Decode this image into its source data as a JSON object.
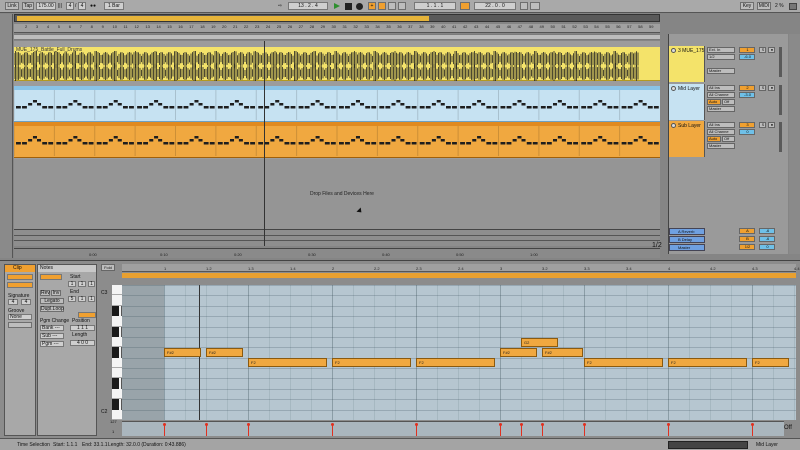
{
  "transport": {
    "link": "Link",
    "tap": "Tap",
    "tempo": "175.00",
    "sig_num": "4",
    "sig_den": "4",
    "quant": "1 Bar",
    "position": "13 .  2 .  4",
    "loop_start": "1 .  1 .  1",
    "loop_length": "22 .  0 .  0",
    "key": "Key",
    "midi": "MIDI",
    "cpu": "2 %"
  },
  "ruler_top": [
    "2",
    "3",
    "4",
    "5",
    "6",
    "7",
    "8",
    "9",
    "10",
    "11",
    "12",
    "13",
    "14",
    "15",
    "16",
    "17",
    "18",
    "19",
    "20",
    "21",
    "22",
    "23",
    "24",
    "25",
    "26",
    "27",
    "28",
    "29",
    "30",
    "31",
    "32",
    "33",
    "34",
    "35",
    "36",
    "37",
    "38",
    "39",
    "40",
    "41",
    "42",
    "43",
    "44",
    "45",
    "46",
    "47",
    "48",
    "49",
    "50",
    "51",
    "52",
    "53",
    "54",
    "55",
    "56",
    "57",
    "58",
    "59"
  ],
  "arrangement": {
    "clip_name": "MUE_175_Battle_Full_Drums",
    "drop_text": "Drop Files and Devices Here",
    "time_ruler": [
      "0:00",
      "0:10",
      "0:20",
      "0:30",
      "0:40",
      "0:50",
      "1:00"
    ],
    "zoom_label": "1/2",
    "colors": {
      "drums": "#f4e36a",
      "mid": "#c6e2f2",
      "sub": "#f0a840"
    }
  },
  "tracks": [
    {
      "name": "3 MUE_175",
      "in": "Ext. In",
      "ch": "1/2",
      "mon": "Master",
      "num": "1",
      "vol": "-6.0"
    },
    {
      "name": "Mid Layer",
      "in": "All Ins",
      "ch": "All Channe",
      "auto": "Auto",
      "off": "Off",
      "mon": "Master",
      "num": "2",
      "vol": "-3.0"
    },
    {
      "name": "Sub Layer",
      "in": "All Ins",
      "ch": "All Channe",
      "auto": "Auto",
      "off": "Off",
      "mon": "Master",
      "num": "3",
      "vol": "0"
    }
  ],
  "returns": [
    {
      "name": "A Reverb",
      "num": "A",
      "vol": "-6"
    },
    {
      "name": "B Delay",
      "num": "B",
      "vol": "-6"
    },
    {
      "name": "Master",
      "num": "1/2",
      "vol": "0"
    }
  ],
  "clip_panel": {
    "clip_title": "Clip",
    "notes_title": "Notes",
    "fold": "Fold",
    "signature": "Signature",
    "sig_num": "4",
    "sig_den": "4",
    "groove": "Groove",
    "groove_val": "None",
    "start": "Start",
    "end": "End",
    "legato": "Legato",
    "dupl_loop": "Dupl.Loop",
    "rev": "Rev",
    "inv": "Inv",
    "pgm_change": "Pgm Change",
    "position": "Position",
    "length": "Length",
    "bank": "Bank ---",
    "sub": "Sub ---",
    "pgm": "Pgm ---",
    "val_1": "1",
    "val_2": "2",
    "val_3": "3",
    "val_4": "4",
    "val_5": "5",
    "pos_val": "1 1 1",
    "len_val": "4 0 0"
  },
  "piano_roll": {
    "ruler": [
      "1",
      "1.2",
      "1.3",
      "1.4",
      "2",
      "2.2",
      "2.3",
      "2.4",
      "3",
      "3.2",
      "3.3",
      "3.4",
      "4",
      "4.2",
      "4.3",
      "4.4"
    ],
    "c3": "C3",
    "c2": "C2",
    "vel_max": "127",
    "vel_min": "1",
    "off": "Off",
    "notes": [
      {
        "label": "F#2",
        "start": 0.0,
        "len": 0.45,
        "row": "fs2"
      },
      {
        "label": "F#2",
        "start": 0.5,
        "len": 0.45,
        "row": "fs2"
      },
      {
        "label": "F2",
        "start": 1.0,
        "len": 0.95,
        "row": "f2"
      },
      {
        "label": "F2",
        "start": 2.0,
        "len": 0.95,
        "row": "f2"
      },
      {
        "label": "F2",
        "start": 3.0,
        "len": 0.95,
        "row": "f2"
      },
      {
        "label": "F#2",
        "start": 4.0,
        "len": 0.45,
        "row": "fs2"
      },
      {
        "label": "G2",
        "start": 4.25,
        "len": 0.45,
        "row": "g2"
      },
      {
        "label": "F#2",
        "start": 4.5,
        "len": 0.5,
        "row": "fs2"
      },
      {
        "label": "F2",
        "start": 5.0,
        "len": 0.95,
        "row": "f2"
      },
      {
        "label": "F2",
        "start": 6.0,
        "len": 0.95,
        "row": "f2"
      },
      {
        "label": "F2",
        "start": 7.0,
        "len": 0.45,
        "row": "f2"
      }
    ]
  },
  "status": {
    "time_selection": "Time Selection",
    "start": "Start: 1.1.1",
    "end": "End: 33.1.1",
    "length": "Length: 32.0.0 (Duration: 0:43.886)",
    "track": "Mid Layer"
  }
}
